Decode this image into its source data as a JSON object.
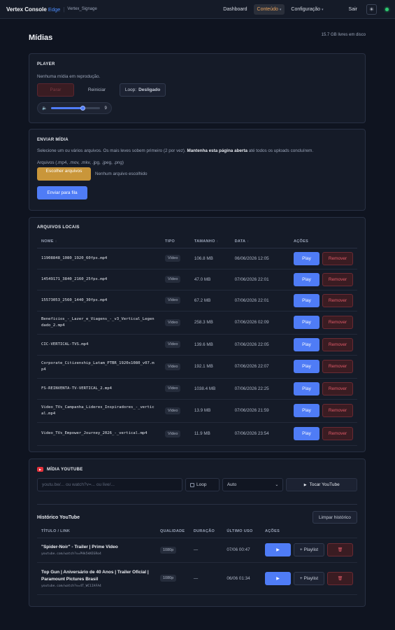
{
  "header": {
    "brand": "Vertex Console",
    "brand_edge": "Edge",
    "brand_sub": "Vertex_Signage",
    "nav": {
      "dashboard": "Dashboard",
      "conteudo": "Conteúdo",
      "configuracao": "Configuração",
      "sair": "Sair"
    },
    "theme_icon": "☀"
  },
  "page": {
    "title": "Mídias",
    "disk": "15.7 GB livres em disco"
  },
  "player": {
    "title": "PLAYER",
    "status": "Nenhuma mídia em reprodução.",
    "stop_label": "Parar",
    "restart_label": "Reiniciar",
    "loop_prefix": "Loop:",
    "loop_value": "Desligado",
    "volume_value": "9",
    "volume_fraction": 0.63
  },
  "upload": {
    "title": "ENVIAR MÍDIA",
    "desc_1": "Selecione um ou vários arquivos. Os mais leves sobem primeiro (2 por vez).",
    "desc_bold": "Mantenha esta página aberta",
    "desc_2": "até todos os uploads concluírem.",
    "formats": "Arquivos (.mp4, .mov, .mkv, .jpg, .jpeg, .png)",
    "choose_label": "Escolher arquivos",
    "no_file": "Nenhum arquivo escolhido",
    "send_label": "Enviar para fila"
  },
  "local_files": {
    "title": "ARQUIVOS LOCAIS",
    "columns": {
      "nome": "NOME",
      "tipo": "TIPO",
      "tamanho": "TAMANHO",
      "data": "DATA",
      "acoes": "AÇÕES"
    },
    "play_label": "Play",
    "remove_label": "Remover",
    "rows": [
      {
        "name": "11908848_1080_1920_60fps.mp4",
        "type": "Vídeo",
        "size": "106.8 MB",
        "date": "06/06/2026 12:05"
      },
      {
        "name": "14549171_3840_2160_25fps.mp4",
        "type": "Vídeo",
        "size": "47.0 MB",
        "date": "07/06/2026 22:01"
      },
      {
        "name": "15573053_2560_1440_30fps.mp4",
        "type": "Vídeo",
        "size": "67.2 MB",
        "date": "07/06/2026 22:01"
      },
      {
        "name": "Beneficios_-_Lazer_e_Viagens_-_v3_Vertical_Legendado_2.mp4",
        "type": "Vídeo",
        "size": "258.3 MB",
        "date": "07/06/2026 02:09"
      },
      {
        "name": "CIC-VERTICAL-TVS.mp4",
        "type": "Vídeo",
        "size": "139.6 MB",
        "date": "07/06/2026 22:05"
      },
      {
        "name": "Corporate_Citizenship_Latam_PTBR_1920x1080_v07.mp4",
        "type": "Vídeo",
        "size": "192.1 MB",
        "date": "07/06/2026 22:07"
      },
      {
        "name": "FS-REINVENTA-TV-VERTICAL_2.mp4",
        "type": "Vídeo",
        "size": "1038.4 MB",
        "date": "07/06/2026 22:25"
      },
      {
        "name": "Video_TVs_Campanha_Lideres_Inspiradores_-_vertical.mp4",
        "type": "Vídeo",
        "size": "13.9 MB",
        "date": "07/06/2026 21:59"
      },
      {
        "name": "Video_TVs_Empower_Journey_2026_-_vertical.mp4",
        "type": "Vídeo",
        "size": "11.9 MB",
        "date": "07/06/2026 23:54"
      }
    ]
  },
  "youtube": {
    "title": "MÍDIA YOUTUBE",
    "placeholder": "youtu.be/... ou watch?v=... ou live/...",
    "loop_label": "Loop",
    "quality_value": "Auto",
    "play_label": "Tocar YouTube",
    "history_title": "Histórico YouTube",
    "clear_label": "Limpar histórico",
    "columns": {
      "titulo": "TÍTULO / LINK",
      "qualidade": "QUALIDADE",
      "duracao": "DURAÇÃO",
      "ultimo": "ÚLTIMO USO",
      "acoes": "AÇÕES"
    },
    "playlist_label": "+ Playlist",
    "rows": [
      {
        "title": "\"Spider-Noir\" - Trailer | Prime Video",
        "url": "youtube.com/watch?v=PHk5kNIGRo4",
        "quality": "1080p",
        "duration": "—",
        "last": "07/06 00:47"
      },
      {
        "title": "Top Gun | Aniversário de 40 Anos | Trailer Oficial | Paramount Pictures Brasil",
        "url": "youtube.com/watch?v=4T_WC1IAFA4",
        "quality": "1080p",
        "duration": "—",
        "last": "06/06 01:34"
      }
    ]
  },
  "colors": {
    "accent": "#4f7cf6",
    "danger": "#e05a68",
    "gold": "#c9963a",
    "status": "#2ecc71",
    "bg": "#0f1420",
    "card": "#151b28"
  }
}
